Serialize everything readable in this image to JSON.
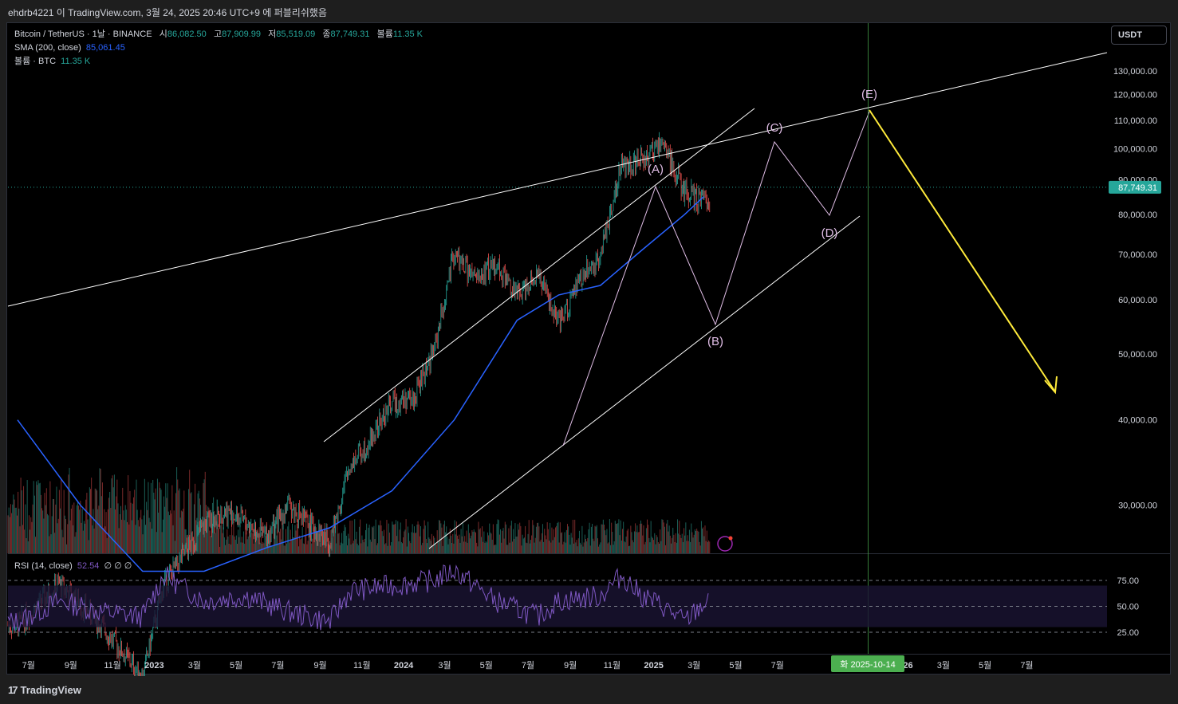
{
  "header": {
    "credit": "ehdrb4221 이 TradingView.com, 3월 24, 2025 20:46 UTC+9 에 퍼블리쉬했음"
  },
  "legend": {
    "symbol": "Bitcoin / TetherUS · 1날 · BINANCE",
    "open_label": "시",
    "open": "86,082.50",
    "high_label": "고",
    "high": "87,909.99",
    "low_label": "저",
    "low": "85,519.09",
    "close_label": "종",
    "close": "87,749.31",
    "vol_label": "볼륨",
    "vol": "11.35 K",
    "sma_label": "SMA (200, close)",
    "sma_value": "85,061.45",
    "volume_label": "볼륨 · BTC",
    "volume_value": "11.35 K"
  },
  "rsi": {
    "label": "RSI (14, close)",
    "value": "52.54",
    "extra": "∅ ∅ ∅"
  },
  "currency_button": "USDT",
  "colors": {
    "up": "#26a69a",
    "down": "#ef5350",
    "sma": "#2962ff",
    "rsi": "#7e57c2",
    "target_arrow": "#ffeb3b",
    "wave": "#e1bee7",
    "crosshair": "#4caf50"
  },
  "chart_data": {
    "type": "line",
    "title": "Bitcoin / TetherUS · 1날 · BINANCE",
    "scale": "log",
    "ylim": [
      25500,
      142000
    ],
    "y_ticks": [
      130000,
      120000,
      110000,
      100000,
      90000,
      80000,
      70000,
      60000,
      50000,
      40000,
      30000
    ],
    "y_tick_labels": [
      "130,000.00",
      "120,000.00",
      "110,000.00",
      "100,000.00",
      "90,000.00",
      "80,000.00",
      "70,000.00",
      "60,000.00",
      "50,000.00",
      "40,000.00",
      "30,000.00"
    ],
    "x_tick_labels": [
      "7월",
      "9월",
      "11월",
      "2023",
      "3월",
      "5월",
      "7월",
      "9월",
      "11월",
      "2024",
      "3월",
      "5월",
      "7월",
      "9월",
      "11월",
      "2025",
      "3월",
      "5월",
      "7월",
      "2026",
      "3월",
      "5월",
      "7월"
    ],
    "current_price": 87749.31,
    "current_price_label": "87,749.31",
    "crosshair_date_label": "화 2025-10-14",
    "price_series": {
      "name": "BTCUSDT",
      "x": [
        "2022-06",
        "2022-08",
        "2022-10",
        "2022-12",
        "2023-01",
        "2023-03",
        "2023-04",
        "2023-06",
        "2023-07",
        "2023-09",
        "2023-10",
        "2023-11",
        "2023-12",
        "2024-01",
        "2024-02",
        "2024-03",
        "2024-04",
        "2024-05",
        "2024-06",
        "2024-07",
        "2024-08",
        "2024-09",
        "2024-10",
        "2024-11",
        "2024-12",
        "2025-01",
        "2025-02",
        "2025-03"
      ],
      "values": [
        20000,
        23000,
        20000,
        16800,
        23000,
        28000,
        29500,
        27000,
        30000,
        26500,
        34500,
        37500,
        42500,
        43000,
        51000,
        70000,
        64000,
        68000,
        61000,
        66000,
        55000,
        64000,
        70000,
        95000,
        96000,
        102000,
        86000,
        84000
      ]
    },
    "sma_series": {
      "name": "SMA (200, close)",
      "x": [
        "2022-06",
        "2022-09",
        "2022-12",
        "2023-03",
        "2023-06",
        "2023-09",
        "2023-12",
        "2024-03",
        "2024-06",
        "2024-08",
        "2024-10",
        "2024-12",
        "2025-02",
        "2025-03"
      ],
      "values": [
        40000,
        30000,
        24000,
        24000,
        26000,
        27800,
        31500,
        40000,
        56000,
        61000,
        63000,
        71000,
        80000,
        85000
      ]
    },
    "rsi_series": {
      "name": "RSI (14, close)",
      "levels": [
        75,
        50,
        25
      ],
      "level_labels": [
        "75.00",
        "50.00",
        "25.00"
      ],
      "x": [
        "2022-06",
        "2022-08",
        "2022-10",
        "2022-12",
        "2023-01",
        "2023-03",
        "2023-05",
        "2023-07",
        "2023-09",
        "2023-10",
        "2023-12",
        "2024-02",
        "2024-03",
        "2024-05",
        "2024-07",
        "2024-08",
        "2024-10",
        "2024-11",
        "2024-12",
        "2025-01",
        "2025-02",
        "2025-03"
      ],
      "values": [
        35,
        55,
        45,
        40,
        80,
        55,
        60,
        45,
        35,
        65,
        70,
        75,
        85,
        55,
        40,
        55,
        60,
        80,
        60,
        50,
        35,
        52.54
      ]
    },
    "wave_labels": [
      "(A)",
      "(B)",
      "(C)",
      "(D)",
      "(E)"
    ]
  }
}
